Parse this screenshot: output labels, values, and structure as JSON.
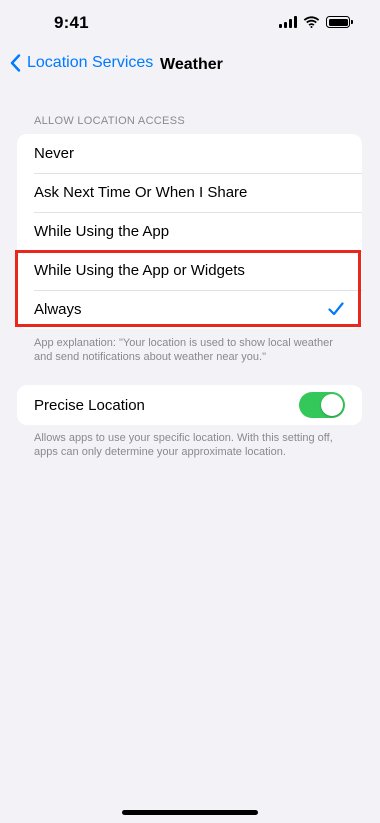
{
  "status_bar": {
    "time": "9:41",
    "icons": [
      "signal-icon",
      "wifi-icon",
      "battery-icon"
    ]
  },
  "nav": {
    "back_label": "Location Services",
    "title": "Weather"
  },
  "location_access": {
    "header": "ALLOW LOCATION ACCESS",
    "options": [
      {
        "label": "Never",
        "selected": false
      },
      {
        "label": "Ask Next Time Or When I Share",
        "selected": false
      },
      {
        "label": "While Using the App",
        "selected": false
      },
      {
        "label": "While Using the App or Widgets",
        "selected": false
      },
      {
        "label": "Always",
        "selected": true
      }
    ],
    "explanation": "App explanation: \"Your location is used to show local weather and send notifications about weather near you.\""
  },
  "precise_location": {
    "label": "Precise Location",
    "enabled": true,
    "description": "Allows apps to use your specific location. With this setting off, apps can only determine your approximate location."
  },
  "colors": {
    "accent": "#007aff",
    "toggle_on": "#34c759",
    "highlight": "#e8271d",
    "background": "#f2f2f7",
    "secondary_text": "#8a8a8e"
  }
}
